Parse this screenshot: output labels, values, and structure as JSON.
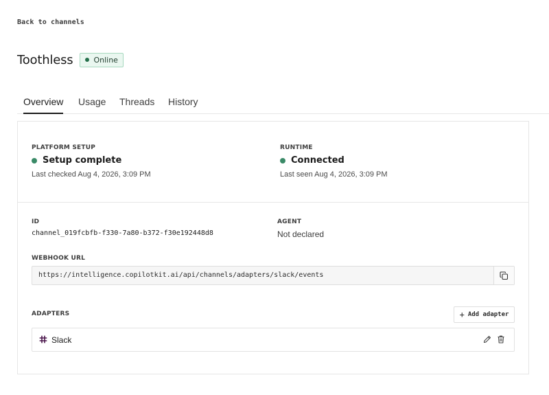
{
  "nav": {
    "back_label": "Back to channels"
  },
  "header": {
    "title": "Toothless",
    "status_badge": "Online"
  },
  "tabs": [
    {
      "label": "Overview",
      "active": true
    },
    {
      "label": "Usage",
      "active": false
    },
    {
      "label": "Threads",
      "active": false
    },
    {
      "label": "History",
      "active": false
    }
  ],
  "platform_setup": {
    "label": "PLATFORM SETUP",
    "status": "Setup complete",
    "detail": "Last checked Aug 4, 2026, 3:09 PM"
  },
  "runtime": {
    "label": "RUNTIME",
    "status": "Connected",
    "detail": "Last seen Aug 4, 2026, 3:09 PM"
  },
  "details": {
    "id_label": "ID",
    "id_value": "channel_019fcbfb-f330-7a80-b372-f30e192448d8",
    "agent_label": "AGENT",
    "agent_value": "Not declared",
    "webhook_label": "WEBHOOK URL",
    "webhook_value": "https://intelligence.copilotkit.ai/api/channels/adapters/slack/events"
  },
  "adapters": {
    "label": "ADAPTERS",
    "add_label": "Add adapter",
    "items": [
      {
        "name": "Slack"
      }
    ]
  },
  "colors": {
    "status_green": "#3a8a67",
    "badge_bg": "#eaf7f0",
    "badge_border": "#a7d8bf",
    "slack_purple": "#4a154b"
  },
  "icons": {
    "copy": "copy-icon",
    "plus": "plus-icon",
    "slack": "slack-icon",
    "edit": "pencil-icon",
    "delete": "trash-icon"
  }
}
